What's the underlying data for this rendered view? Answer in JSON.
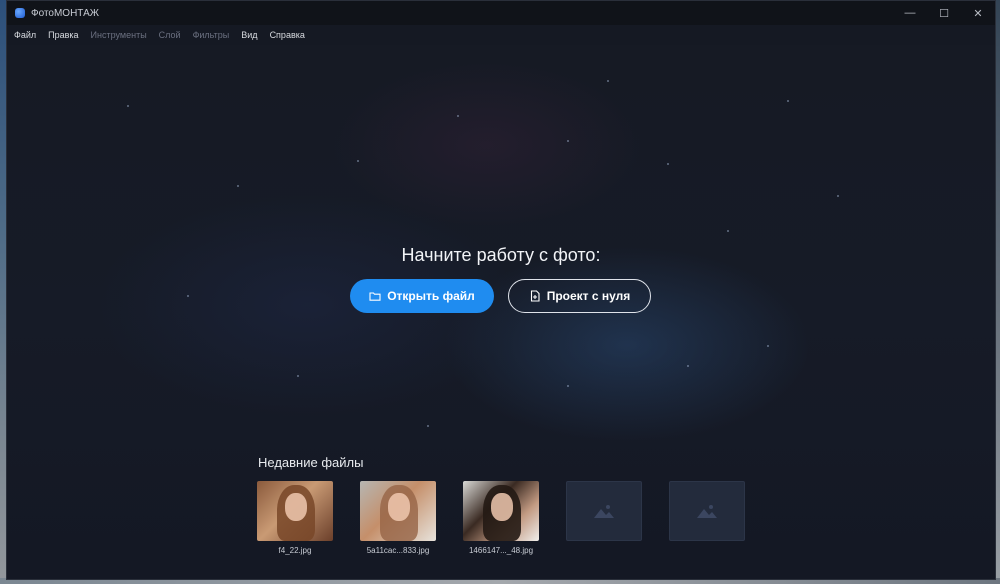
{
  "window": {
    "title": "ФотоМОНТАЖ",
    "controls": {
      "minimize": "—",
      "maximize": "☐",
      "close": "✕"
    }
  },
  "menu": {
    "items": [
      {
        "label": "Файл",
        "enabled": true
      },
      {
        "label": "Правка",
        "enabled": true
      },
      {
        "label": "Инструменты",
        "enabled": false
      },
      {
        "label": "Слой",
        "enabled": false
      },
      {
        "label": "Фильтры",
        "enabled": false
      },
      {
        "label": "Вид",
        "enabled": true
      },
      {
        "label": "Справка",
        "enabled": true
      }
    ]
  },
  "start": {
    "headline": "Начните работу с фото:",
    "open_file_label": "Открыть файл",
    "new_project_label": "Проект с нуля",
    "open_file_icon": "folder-icon",
    "new_project_icon": "new-file-icon"
  },
  "recent": {
    "title": "Недавние файлы",
    "files": [
      {
        "name": "f4_22.jpg"
      },
      {
        "name": "5a11cac...833.jpg"
      },
      {
        "name": "1466147..._48.jpg"
      }
    ],
    "placeholder_icon": "image-placeholder-icon"
  },
  "colors": {
    "accent": "#1f8cf0",
    "background": "#151923"
  }
}
